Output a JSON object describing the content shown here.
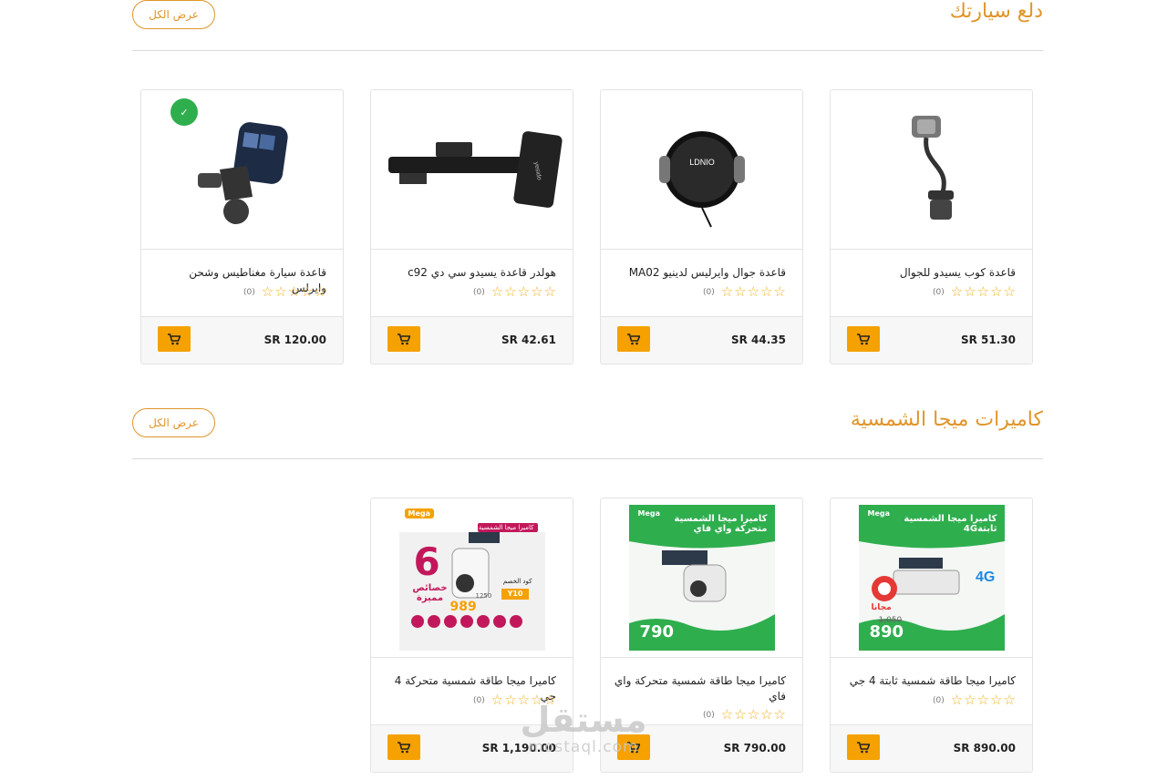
{
  "sections": [
    {
      "title": "دلع سيارتك",
      "view_all": "عرض الكل",
      "products": [
        {
          "name": "قاعدة كوب يسيدو للجوال",
          "rating_count": "(0)",
          "price": "SR 51.30"
        },
        {
          "name": "قاعدة جوال وايرليس لدينيو MA02",
          "rating_count": "(0)",
          "price": "SR 44.35"
        },
        {
          "name": "هولدر قاعدة يسيدو سي دي c92",
          "rating_count": "(0)",
          "price": "SR 42.61"
        },
        {
          "name": "قاعدة سيارة مغناطيس وشحن وايرلس",
          "rating_count": "(0)",
          "price": "SR 120.00"
        }
      ]
    },
    {
      "title": "كاميرات ميجا الشمسية",
      "view_all": "عرض الكل",
      "products": [
        {
          "name": "كاميرا ميجا طاقة شمسية ثابتة 4 جي",
          "rating_count": "(0)",
          "price": "SR 890.00",
          "promo": {
            "headline": "كاميرا ميجا الشمسية ثابتة4G",
            "price": "890",
            "old_price": "1,050",
            "free": "مجانا",
            "tag": "4G",
            "logo": "Mega"
          }
        },
        {
          "name": "كاميرا ميجا طاقة شمسية متحركة واي فاي",
          "rating_count": "(0)",
          "price": "SR 790.00",
          "promo": {
            "headline": "كاميرا ميجا الشمسية متحركة واي فاي",
            "price": "790",
            "logo": "Mega"
          }
        },
        {
          "name": "كاميرا ميجا طاقة شمسية متحركة 4 جي",
          "rating_count": "(0)",
          "price": "SR 1,190.00",
          "promo": {
            "headline": "كاميرا ميجا الشمسية",
            "big_number": "6",
            "features": "خصائص مميزة",
            "price": "989",
            "old_price": "1250",
            "code_label": "كود الخصم",
            "code": "Y10",
            "logo": "Mega"
          }
        }
      ]
    }
  ],
  "watermark": {
    "arabic": "مستقل",
    "latin": "mostaql.com"
  },
  "colors": {
    "accent": "#e0952a",
    "cart": "#f5a100",
    "star": "#f2b01e",
    "green": "#2fae4e"
  }
}
